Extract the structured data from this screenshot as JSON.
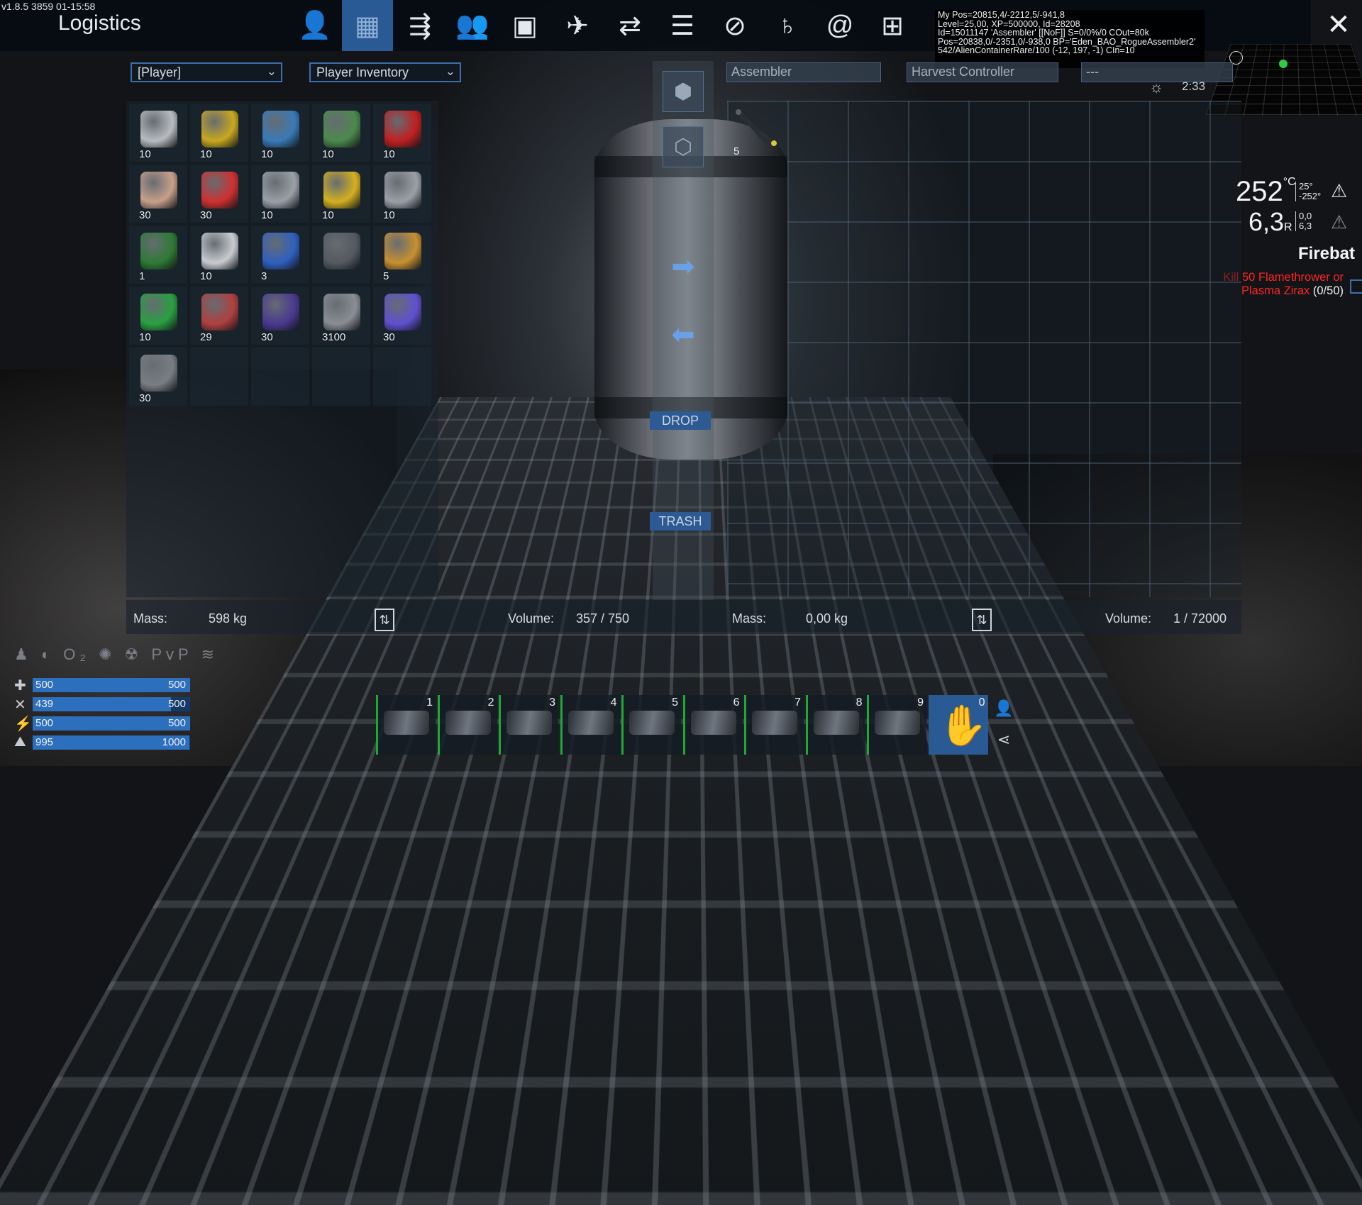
{
  "version": "v1.8.5 3859 01-15:58",
  "title": "Logistics",
  "nav": [
    {
      "name": "player-icon",
      "glyph": "👤"
    },
    {
      "name": "logistics-icon",
      "glyph": "▦",
      "active": true
    },
    {
      "name": "tech-tree-icon",
      "glyph": "⇶"
    },
    {
      "name": "faction-icon",
      "glyph": "👥"
    },
    {
      "name": "window-icon",
      "glyph": "▣"
    },
    {
      "name": "vehicle-icon",
      "glyph": "✈"
    },
    {
      "name": "exchange-icon",
      "glyph": "⇄"
    },
    {
      "name": "list-icon",
      "glyph": "☰"
    },
    {
      "name": "compass-icon",
      "glyph": "⊘"
    },
    {
      "name": "planet-icon",
      "glyph": "♄"
    },
    {
      "name": "galaxy-icon",
      "glyph": "@"
    },
    {
      "name": "settings-icon",
      "glyph": "⊞"
    }
  ],
  "close_glyph": "✕",
  "debug": [
    "My Pos=20815,4/-2212,5/-941,8",
    "Level=25,00, XP=500000, Id=28208",
    "Id=15011147 'Assembler' [[NoF]] S=0/0%/0 COut=80k",
    "Pos=20838,0/-2351,0/-938,0 BP='Eden_BAO_RogueAssembler2'",
    "542/AlienContainerRare/100 (-12, 197, -1) CIn=10"
  ],
  "left": {
    "owner_select": "[Player]",
    "inventory_select": "Player Inventory",
    "items": [
      {
        "count": "10",
        "color": "#b8bcc0"
      },
      {
        "count": "10",
        "color": "#c9a820"
      },
      {
        "count": "10",
        "color": "#3a7ab8"
      },
      {
        "count": "10",
        "color": "#4c8a4c"
      },
      {
        "count": "10",
        "color": "#c02020"
      },
      {
        "count": "30",
        "color": "#c8a08a"
      },
      {
        "count": "30",
        "color": "#d03030"
      },
      {
        "count": "10",
        "color": "#9aa0a6"
      },
      {
        "count": "10",
        "color": "#d4b020"
      },
      {
        "count": "10",
        "color": "#9aa0a6"
      },
      {
        "count": "1",
        "color": "#2f7a35"
      },
      {
        "count": "10",
        "color": "#c8ccd0"
      },
      {
        "count": "3",
        "color": "#3060c0"
      },
      {
        "count": "",
        "color": "#555a60"
      },
      {
        "count": "5",
        "color": "#c89030"
      },
      {
        "count": "10",
        "color": "#2aa040"
      },
      {
        "count": "29",
        "color": "#b04040"
      },
      {
        "count": "30",
        "color": "#4a3a90"
      },
      {
        "count": "3100",
        "color": "#8a8e94"
      },
      {
        "count": "30",
        "color": "#6050d0"
      },
      {
        "count": "30",
        "color": "#7a7e84"
      }
    ],
    "mass_label": "Mass:",
    "mass_value": "598 kg",
    "volume_label": "Volume:",
    "volume_value": "357 / 750"
  },
  "middle": {
    "drop_label": "DROP",
    "trash_label": "TRASH"
  },
  "right": {
    "device_name": "Assembler",
    "controller": "Harvest Controller",
    "filter": "---",
    "time": "2:33",
    "item_count": "5",
    "mass_label": "Mass:",
    "mass_value": "0,00 kg",
    "volume_label": "Volume:",
    "volume_value": "1 / 72000"
  },
  "hud": {
    "temp": "252",
    "temp_unit": "°C",
    "temp_max": "25°",
    "temp_min": "-252°",
    "rad": "6,3",
    "rad_unit": "R",
    "rad_a": "0,0",
    "rad_b": "6,3",
    "mission_title": "Firebat",
    "mission_dim": "Kill",
    "mission_red": "50 Flamethrower or Plasma Zirax",
    "mission_progress": "(0/50)"
  },
  "status_icons": "♟ ◐ O₂ ✺ ☢ PvP ≋",
  "stats": [
    {
      "name": "health",
      "icon": "✚",
      "current": "500",
      "max": "500",
      "fraction": 1.0
    },
    {
      "name": "food",
      "icon": "✕",
      "current": "439",
      "max": "500",
      "fraction": 0.878
    },
    {
      "name": "stamina",
      "icon": "⚡",
      "current": "500",
      "max": "500",
      "fraction": 1.0
    },
    {
      "name": "oxygen",
      "icon": "⛰",
      "current": "995",
      "max": "1000",
      "fraction": 0.995
    }
  ],
  "hotbar": [
    "1",
    "2",
    "3",
    "4",
    "5",
    "6",
    "7",
    "8",
    "9",
    "0"
  ]
}
